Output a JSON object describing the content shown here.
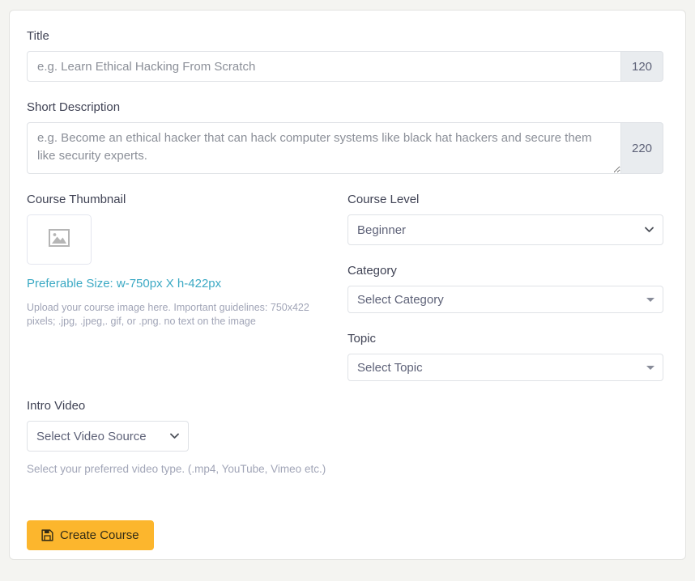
{
  "form": {
    "title_field": {
      "label": "Title",
      "placeholder": "e.g. Learn Ethical Hacking From Scratch",
      "value": "",
      "counter": "120"
    },
    "short_description_field": {
      "label": "Short Description",
      "placeholder": "e.g. Become an ethical hacker that can hack computer systems like black hat hackers and secure them like security experts.",
      "value": "",
      "counter": "220"
    },
    "course_thumbnail": {
      "label": "Course Thumbnail",
      "placeholder_icon": "image-placeholder-icon",
      "preferable_size": "Preferable Size: w-750px X h-422px",
      "help_text": "Upload your course image here. Important guidelines: 750x422 pixels; .jpg, .jpeg,. gif, or .png. no text on the image",
      "link_color": "#3ba9c4"
    },
    "course_level": {
      "label": "Course Level",
      "selected": "Beginner",
      "options": [
        "Beginner"
      ]
    },
    "category": {
      "label": "Category",
      "selected": "Select Category",
      "options": [
        "Select Category"
      ]
    },
    "topic": {
      "label": "Topic",
      "selected": "Select Topic",
      "options": [
        "Select Topic"
      ]
    },
    "intro_video": {
      "label": "Intro Video",
      "selected": "Select Video Source",
      "options": [
        "Select Video Source"
      ],
      "help_text": "Select your preferred video type. (.mp4, YouTube, Vimeo etc.)"
    },
    "submit": {
      "label": "Create Course",
      "icon": "save-floppy-icon",
      "background_color": "#fcb62d"
    }
  }
}
